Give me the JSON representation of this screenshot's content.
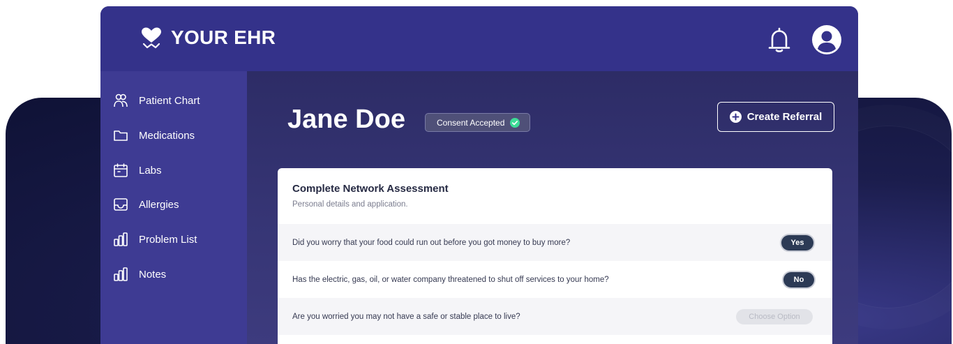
{
  "brand": {
    "name": "YOUR EHR",
    "logo_icon": "heart-check-icon"
  },
  "header": {
    "notification_icon": "bell-icon",
    "profile_icon": "user-avatar-icon"
  },
  "sidebar": {
    "items": [
      {
        "label": "Patient Chart",
        "icon": "people-icon"
      },
      {
        "label": "Medications",
        "icon": "folder-icon"
      },
      {
        "label": "Labs",
        "icon": "calendar-icon"
      },
      {
        "label": "Allergies",
        "icon": "inbox-icon"
      },
      {
        "label": "Problem List",
        "icon": "bar-chart-icon"
      },
      {
        "label": "Notes",
        "icon": "bar-chart-icon"
      }
    ]
  },
  "patient": {
    "name": "Jane Doe",
    "consent_label": "Consent Accepted",
    "consent_color": "#3ddc97"
  },
  "actions": {
    "create_referral_label": "Create Referral"
  },
  "assessment": {
    "title": "Complete Network Assessment",
    "subtitle": "Personal details and application.",
    "questions": [
      {
        "text": "Did you worry that your food could run out before you got money to buy more?",
        "answer": "Yes"
      },
      {
        "text": "Has the electric, gas, oil, or water company threatened to shut off services to your home?",
        "answer": "No"
      },
      {
        "text": "Are you worried you may not have a safe or stable place to live?",
        "answer": "Choose Option"
      }
    ]
  },
  "colors": {
    "header_bg": "#34328a",
    "sidebar_bg": "#3e3b93",
    "answer_pill": "#2c3a55"
  }
}
